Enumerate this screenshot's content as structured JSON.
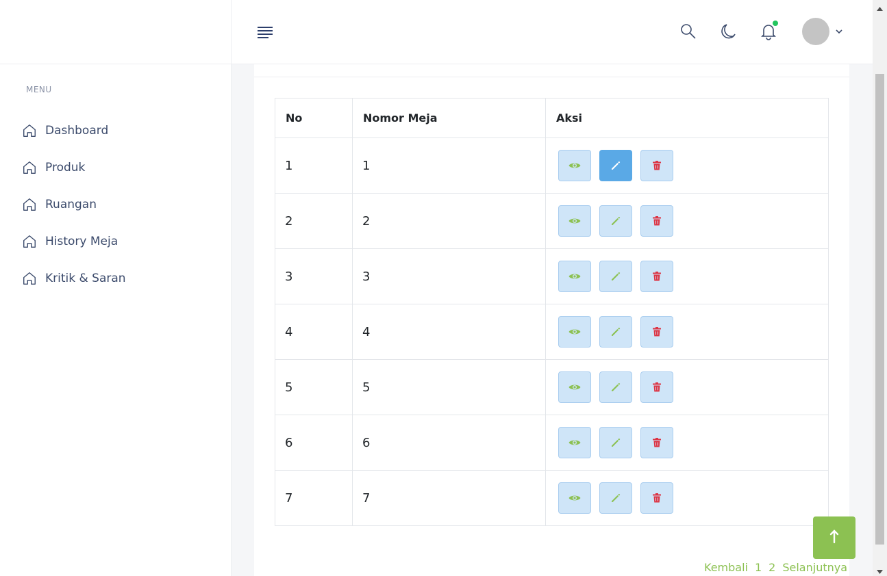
{
  "sidebar": {
    "menu_heading": "MENU",
    "items": [
      {
        "label": "Dashboard",
        "icon": "home-icon"
      },
      {
        "label": "Produk",
        "icon": "home-icon"
      },
      {
        "label": "Ruangan",
        "icon": "home-icon"
      },
      {
        "label": "History Meja",
        "icon": "home-icon"
      },
      {
        "label": "Kritik & Saran",
        "icon": "home-icon"
      }
    ]
  },
  "header": {
    "icons": [
      "menu-icon",
      "search-icon",
      "moon-icon",
      "bell-icon",
      "chevron-down-icon"
    ],
    "notification_dot_color": "#22c55e"
  },
  "table": {
    "headers": [
      "No",
      "Nomor Meja",
      "Aksi"
    ],
    "rows": [
      {
        "no": "1",
        "nomor_meja": "1"
      },
      {
        "no": "2",
        "nomor_meja": "2"
      },
      {
        "no": "3",
        "nomor_meja": "3"
      },
      {
        "no": "4",
        "nomor_meja": "4"
      },
      {
        "no": "5",
        "nomor_meja": "5"
      },
      {
        "no": "6",
        "nomor_meja": "6"
      },
      {
        "no": "7",
        "nomor_meja": "7"
      }
    ],
    "actions": [
      "eye-icon",
      "pencil-icon",
      "trash-icon"
    ]
  },
  "pagination": {
    "prev": "Kembali",
    "pages": [
      "1",
      "2"
    ],
    "next": "Selanjutnya"
  },
  "colors": {
    "accent_green": "#8cc152",
    "danger_red": "#dc3545",
    "button_bg": "#cfe5f8",
    "button_active_bg": "#5aa9e6"
  }
}
